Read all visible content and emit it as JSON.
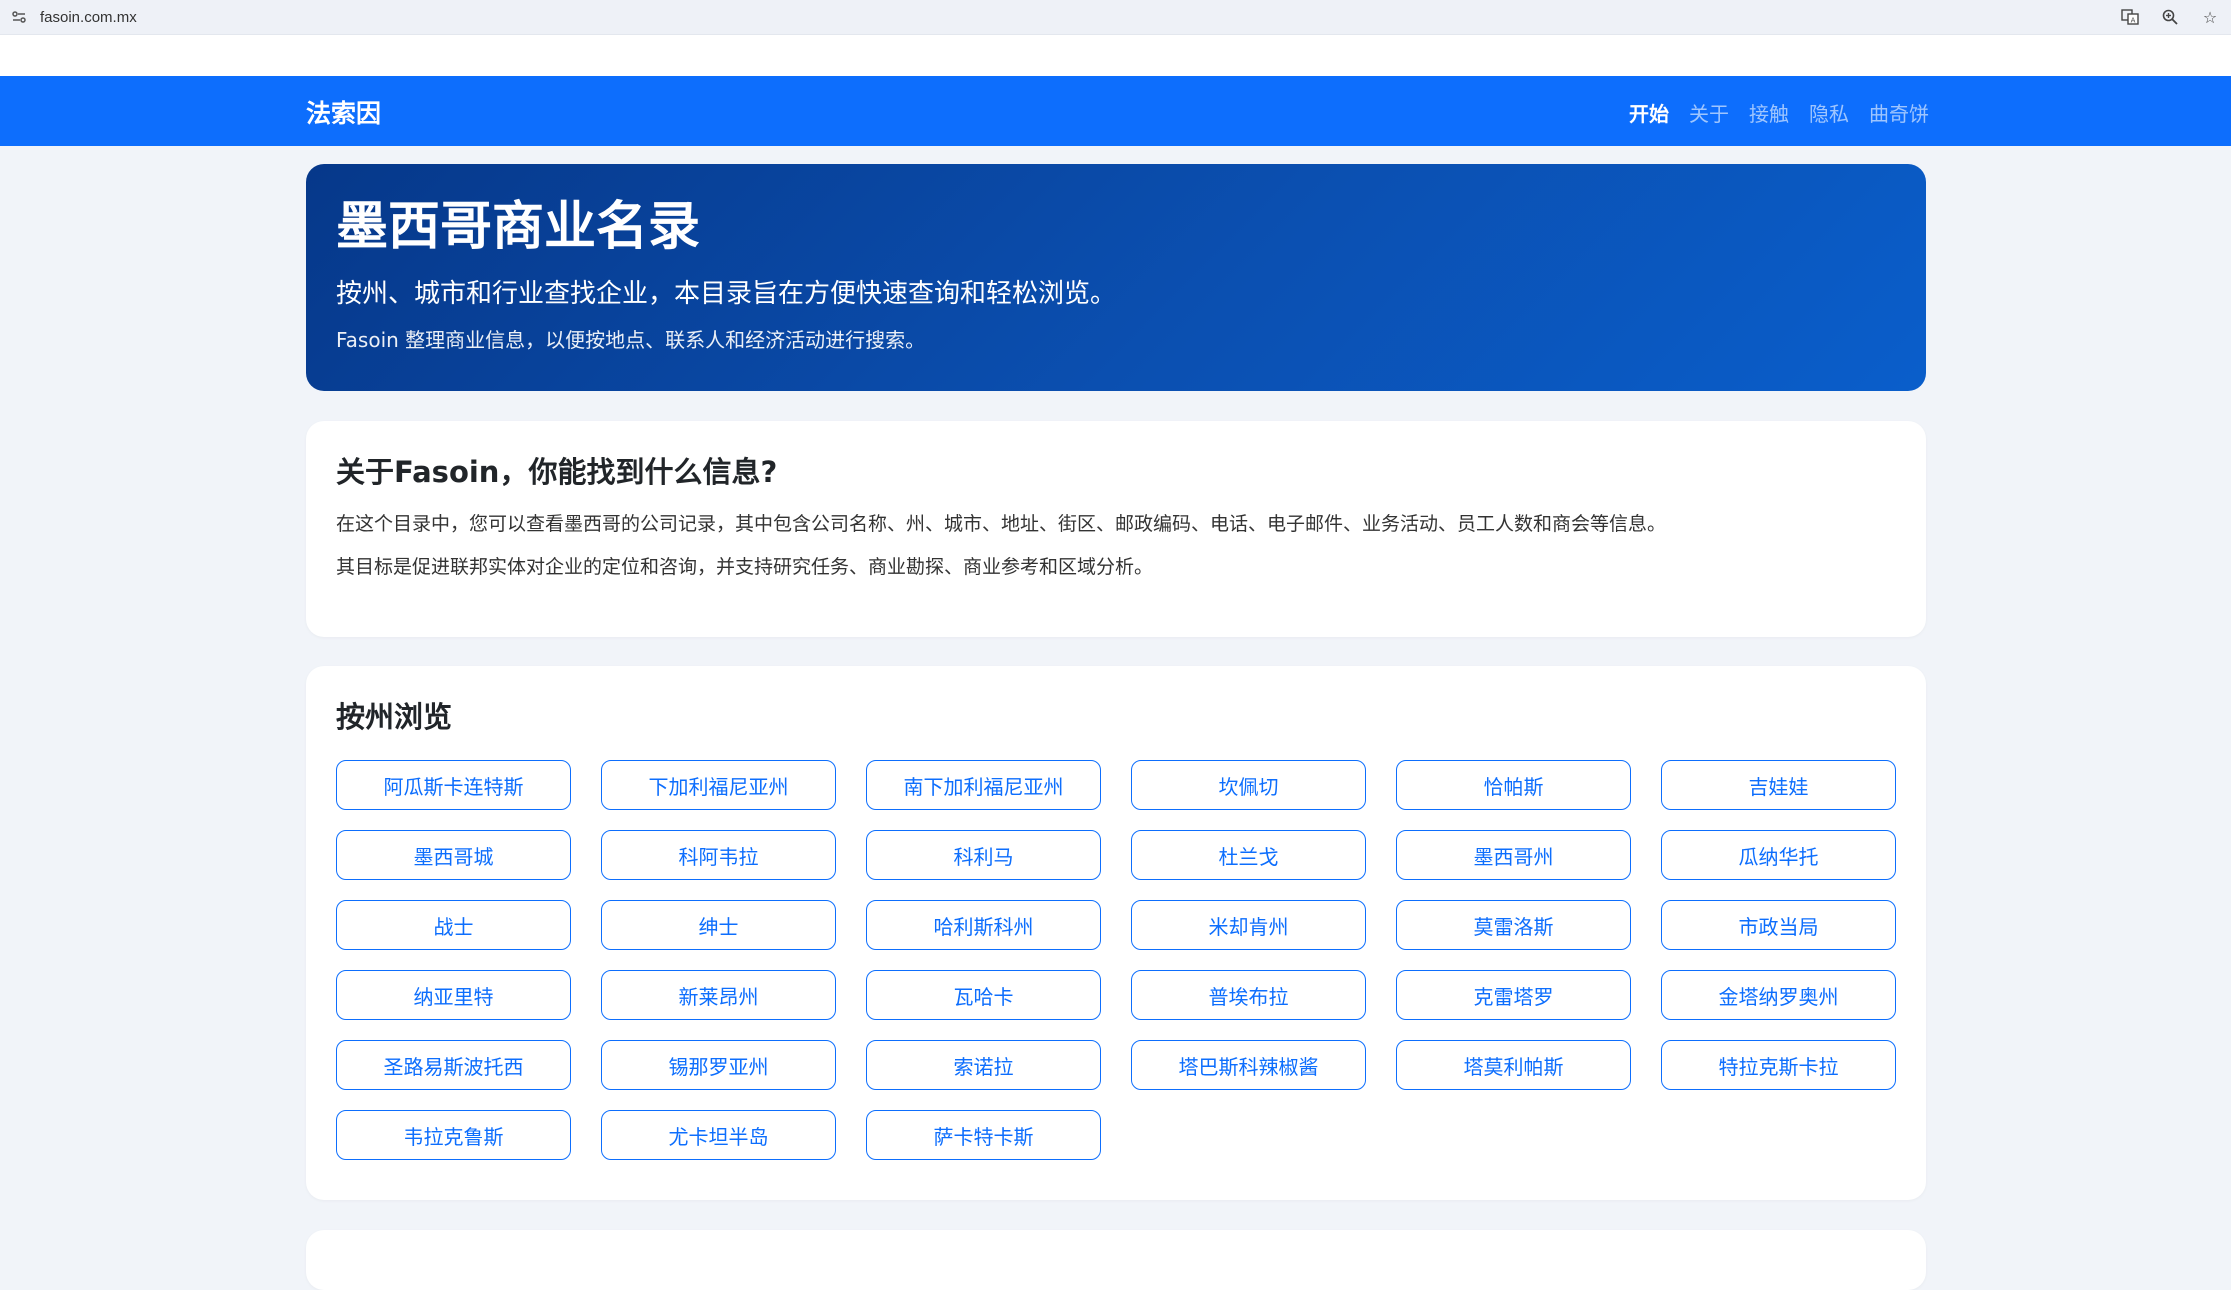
{
  "browser": {
    "url": "fasoin.com.mx",
    "icons": [
      "site-settings-icon",
      "translate-icon",
      "zoom-icon",
      "bookmark-star-icon"
    ]
  },
  "navbar": {
    "brand": "法索因",
    "links": [
      "开始",
      "关于",
      "接触",
      "隐私",
      "曲奇饼"
    ]
  },
  "hero": {
    "title": "墨西哥商业名录",
    "lead": "按州、城市和行业查找企业，本目录旨在方便快速查询和轻松浏览。",
    "sub": "Fasoin 整理商业信息，以便按地点、联系人和经济活动进行搜索。"
  },
  "about": {
    "title": "关于Fasoin，你能找到什么信息?",
    "p1": "在这个目录中，您可以查看墨西哥的公司记录，其中包含公司名称、州、城市、地址、街区、邮政编码、电话、电子邮件、业务活动、员工人数和商会等信息。",
    "p2": "其目标是促进联邦实体对企业的定位和咨询，并支持研究任务、商业勘探、商业参考和区域分析。"
  },
  "states": {
    "title": "按州浏览",
    "items": [
      "阿瓜斯卡连特斯",
      "下加利福尼亚州",
      "南下加利福尼亚州",
      "坎佩切",
      "恰帕斯",
      "吉娃娃",
      "墨西哥城",
      "科阿韦拉",
      "科利马",
      "杜兰戈",
      "墨西哥州",
      "瓜纳华托",
      "战士",
      "绅士",
      "哈利斯科州",
      "米却肯州",
      "莫雷洛斯",
      "市政当局",
      "纳亚里特",
      "新莱昂州",
      "瓦哈卡",
      "普埃布拉",
      "克雷塔罗",
      "金塔纳罗奥州",
      "圣路易斯波托西",
      "锡那罗亚州",
      "索诺拉",
      "塔巴斯科辣椒酱",
      "塔莫利帕斯",
      "特拉克斯卡拉",
      "韦拉克鲁斯",
      "尤卡坦半岛",
      "萨卡特卡斯"
    ]
  },
  "colors": {
    "primary": "#0d6efd",
    "hero_start": "#06388a",
    "hero_end": "#0a5ecb",
    "page_bg": "#f1f4f9"
  }
}
